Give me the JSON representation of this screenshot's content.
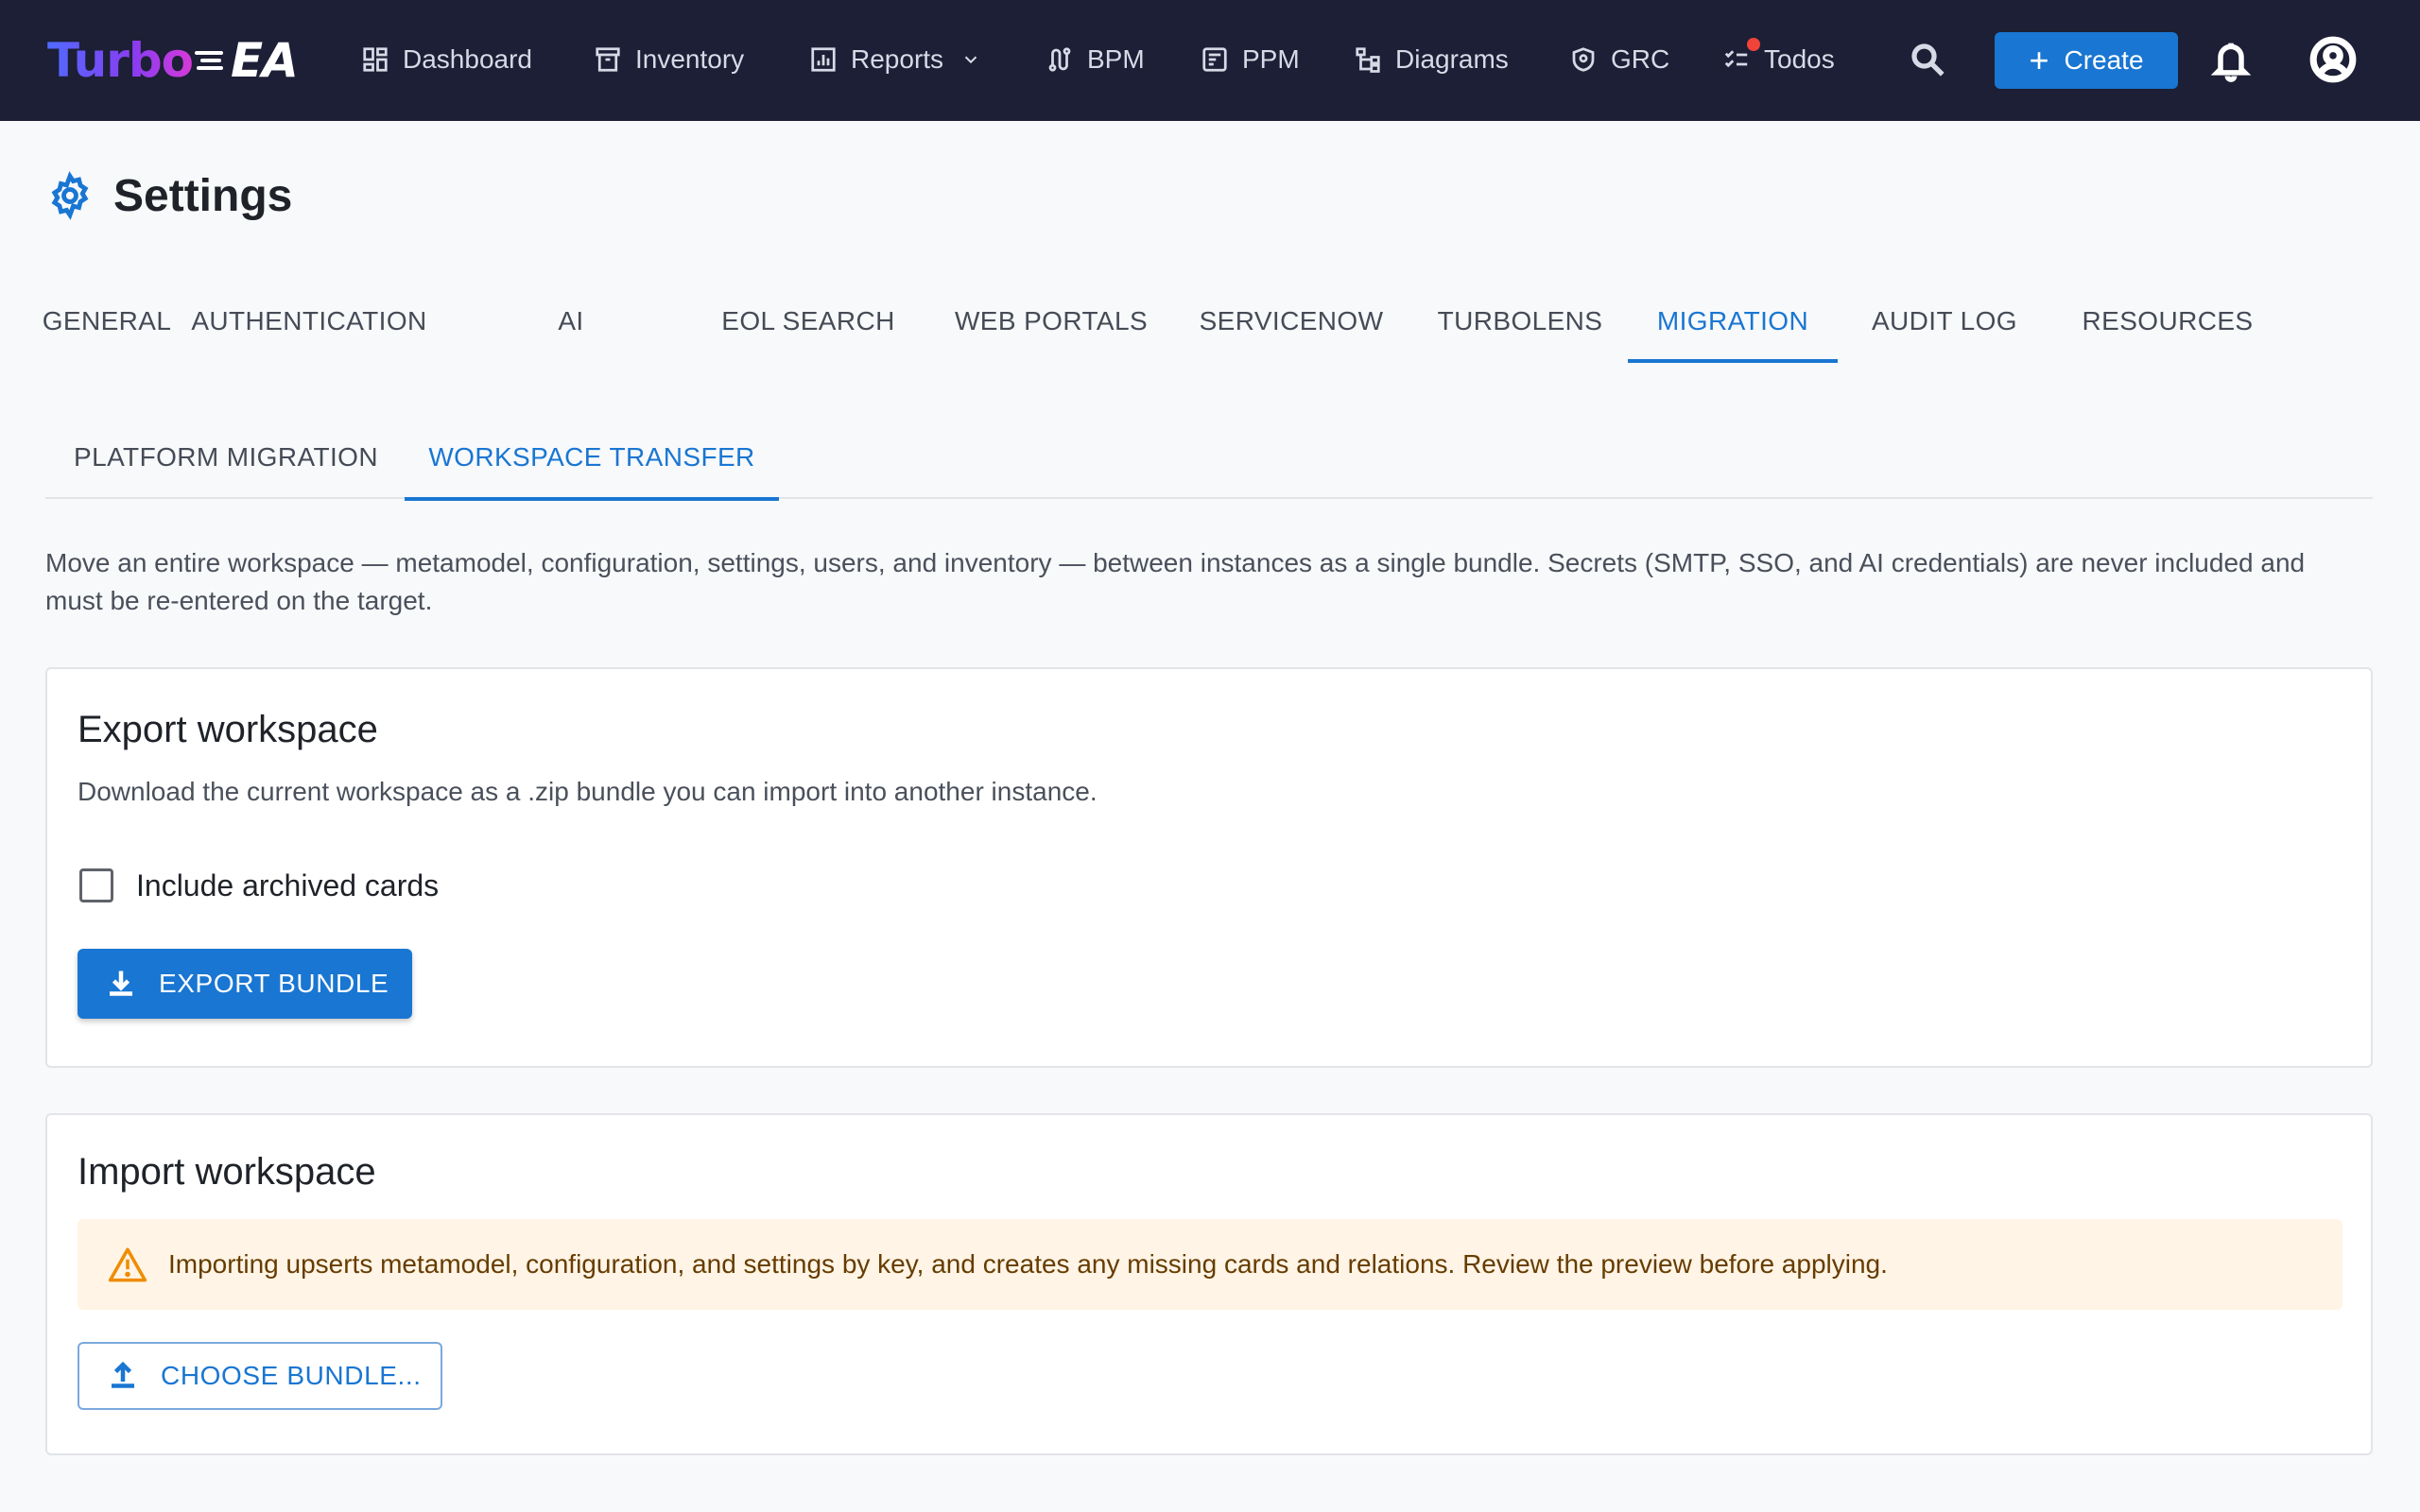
{
  "app": {
    "logo_primary": "Turbo",
    "logo_secondary": "EA"
  },
  "nav": {
    "items": [
      {
        "label": "Dashboard",
        "icon": "dashboard-icon"
      },
      {
        "label": "Inventory",
        "icon": "archive-icon"
      },
      {
        "label": "Reports",
        "icon": "chart-icon",
        "has_dropdown": true
      },
      {
        "label": "BPM",
        "icon": "route-icon"
      },
      {
        "label": "PPM",
        "icon": "project-icon"
      },
      {
        "label": "Diagrams",
        "icon": "diagram-icon"
      },
      {
        "label": "GRC",
        "icon": "shield-icon"
      },
      {
        "label": "Todos",
        "icon": "checklist-icon",
        "has_notification_dot": true
      }
    ],
    "search_icon": "search-icon",
    "create_label": "Create",
    "notifications_icon": "bell-icon",
    "account_icon": "user-circle-icon"
  },
  "page": {
    "title": "Settings",
    "title_icon": "gear-icon"
  },
  "tabs": [
    {
      "label": "GENERAL",
      "active": false
    },
    {
      "label": "AUTHENTICATION",
      "active": false
    },
    {
      "label": "AI",
      "active": false
    },
    {
      "label": "EOL SEARCH",
      "active": false
    },
    {
      "label": "WEB PORTALS",
      "active": false
    },
    {
      "label": "SERVICENOW",
      "active": false
    },
    {
      "label": "TURBOLENS",
      "active": false
    },
    {
      "label": "MIGRATION",
      "active": true
    },
    {
      "label": "AUDIT LOG",
      "active": false
    },
    {
      "label": "RESOURCES",
      "active": false
    }
  ],
  "subtabs": [
    {
      "label": "PLATFORM MIGRATION",
      "active": false
    },
    {
      "label": "WORKSPACE TRANSFER",
      "active": true
    }
  ],
  "intro": "Move an entire workspace — metamodel, configuration, settings, users, and inventory — between instances as a single bundle. Secrets (SMTP, SSO, and AI credentials) are never included and must be re-entered on the target.",
  "export": {
    "title": "Export workspace",
    "description": "Download the current workspace as a .zip bundle you can import into another instance.",
    "checkbox_label": "Include archived cards",
    "checkbox_checked": false,
    "button_label": "EXPORT BUNDLE"
  },
  "import": {
    "title": "Import workspace",
    "warning": "Importing upserts metamodel, configuration, and settings by key, and creates any missing cards and relations. Review the preview before applying.",
    "button_label": "CHOOSE BUNDLE..."
  },
  "colors": {
    "topbar": "#1c1f35",
    "accent": "#1976d2",
    "warning_bg": "#fff4e5",
    "warning_text": "#663c00",
    "notification_dot": "#f0433a"
  }
}
